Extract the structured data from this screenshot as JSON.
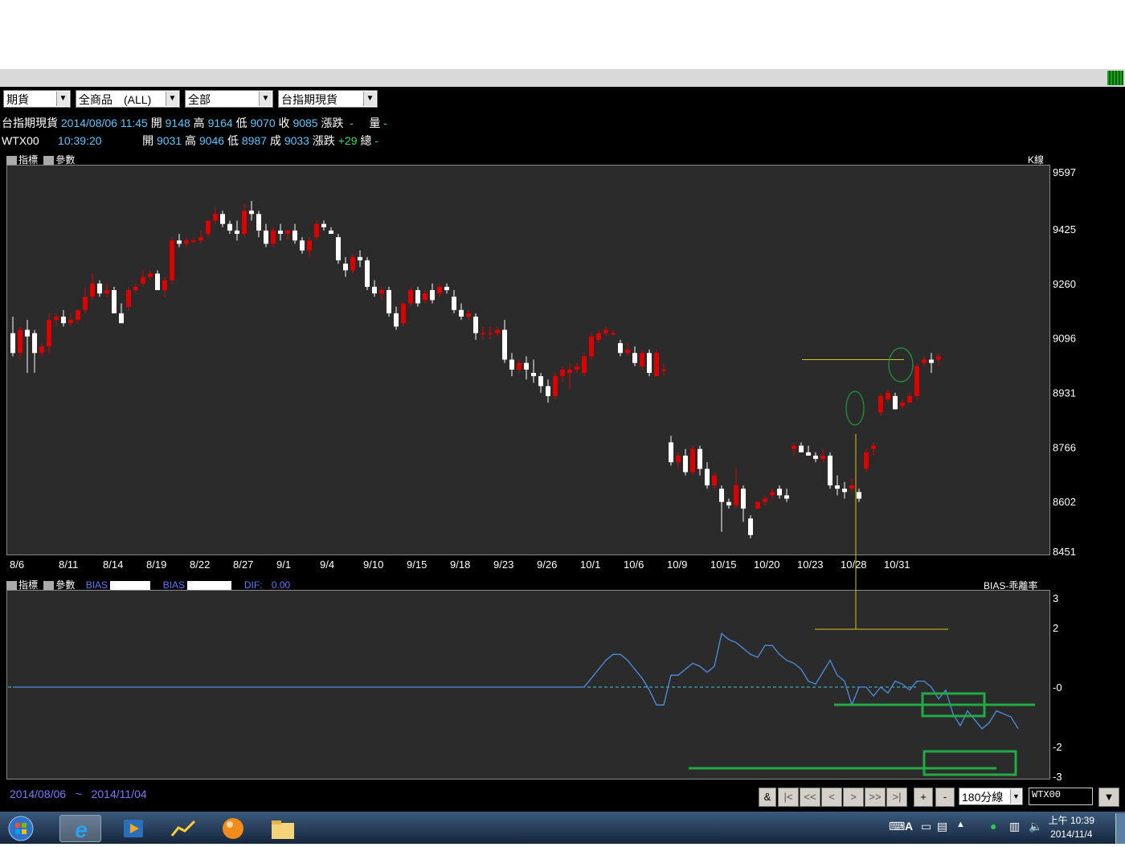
{
  "filters": {
    "market": "期貨",
    "product": "全商品　(ALL)",
    "scope": "全部",
    "symbol": "台指期現貨"
  },
  "quote_row1": {
    "name": "台指期現貨",
    "datetime": "2014/08/06 11:45",
    "open_label": "開",
    "open": "9148",
    "high_label": "高",
    "high": "9164",
    "low_label": "低",
    "low": "9070",
    "close_label": "收",
    "close": "9085",
    "change_label": "漲跌",
    "change": "-",
    "volume_label": "量",
    "volume": "-"
  },
  "quote_row2": {
    "name": "WTX00",
    "time": "10:39:20",
    "open_label": "開",
    "open": "9031",
    "high_label": "高",
    "high": "9046",
    "low_label": "低",
    "low": "8987",
    "close_label": "成",
    "close": "9033",
    "change_label": "漲跌",
    "change": "+29",
    "volume_label": "總",
    "volume": "-"
  },
  "price_panel": {
    "indicator_btn": "指標",
    "param_btn": "參數",
    "chart_type": "K線"
  },
  "bias_panel": {
    "indicator_btn": "指標",
    "param_btn": "參數",
    "bias1_label": "BIAS",
    "bias2_label": "BIAS",
    "dif_label": "DIF:",
    "dif_value": "0.00",
    "title": "BIAS-乖離率"
  },
  "chart_data": [
    {
      "type": "candlestick",
      "title": "K線",
      "ylim": [
        8451,
        9597
      ],
      "y_ticks": [
        9597,
        9425,
        9260,
        9096,
        8931,
        8766,
        8602,
        8451
      ],
      "x_ticks": [
        "8/6",
        "8/11",
        "8/14",
        "8/19",
        "8/22",
        "8/27",
        "9/1",
        "9/4",
        "9/10",
        "9/15",
        "9/18",
        "9/23",
        "9/26",
        "10/1",
        "10/6",
        "10/9",
        "10/15",
        "10/20",
        "10/23",
        "10/28",
        "10/31"
      ],
      "colors": {
        "up": "#dd0000",
        "down": "#ffffff",
        "background": "#2b2b2b"
      },
      "candles": [
        [
          9110,
          9160,
          9040,
          9050
        ],
        [
          9050,
          9130,
          9030,
          9120
        ],
        [
          9120,
          9150,
          8990,
          9100
        ],
        [
          9110,
          9120,
          8990,
          9050
        ],
        [
          9050,
          9080,
          9040,
          9070
        ],
        [
          9070,
          9170,
          9050,
          9150
        ],
        [
          9150,
          9170,
          9130,
          9160
        ],
        [
          9160,
          9180,
          9130,
          9140
        ],
        [
          9140,
          9170,
          9130,
          9150
        ],
        [
          9150,
          9180,
          9140,
          9180
        ],
        [
          9180,
          9250,
          9170,
          9220
        ],
        [
          9220,
          9290,
          9210,
          9260
        ],
        [
          9260,
          9270,
          9220,
          9230
        ],
        [
          9230,
          9260,
          9220,
          9240
        ],
        [
          9240,
          9250,
          9170,
          9170
        ],
        [
          9170,
          9200,
          9140,
          9140
        ],
        [
          9190,
          9250,
          9180,
          9240
        ],
        [
          9240,
          9260,
          9230,
          9250
        ],
        [
          9260,
          9300,
          9250,
          9280
        ],
        [
          9280,
          9300,
          9270,
          9290
        ],
        [
          9290,
          9300,
          9240,
          9240
        ],
        [
          9240,
          9280,
          9220,
          9270
        ],
        [
          9270,
          9400,
          9260,
          9390
        ],
        [
          9390,
          9410,
          9370,
          9380
        ],
        [
          9380,
          9400,
          9370,
          9390
        ],
        [
          9390,
          9400,
          9380,
          9390
        ],
        [
          9390,
          9420,
          9380,
          9400
        ],
        [
          9410,
          9450,
          9400,
          9450
        ],
        [
          9450,
          9490,
          9440,
          9470
        ],
        [
          9470,
          9480,
          9430,
          9440
        ],
        [
          9440,
          9450,
          9410,
          9420
        ],
        [
          9420,
          9450,
          9390,
          9410
        ],
        [
          9410,
          9500,
          9400,
          9480
        ],
        [
          9480,
          9510,
          9450,
          9470
        ],
        [
          9470,
          9480,
          9400,
          9420
        ],
        [
          9420,
          9440,
          9370,
          9380
        ],
        [
          9380,
          9430,
          9370,
          9420
        ],
        [
          9420,
          9440,
          9390,
          9410
        ],
        [
          9410,
          9420,
          9390,
          9420
        ],
        [
          9420,
          9440,
          9380,
          9390
        ],
        [
          9390,
          9400,
          9350,
          9360
        ],
        [
          9360,
          9400,
          9340,
          9390
        ],
        [
          9400,
          9450,
          9390,
          9440
        ],
        [
          9440,
          9450,
          9420,
          9430
        ],
        [
          9420,
          9430,
          9410,
          9410
        ],
        [
          9400,
          9410,
          9320,
          9330
        ],
        [
          9320,
          9340,
          9280,
          9300
        ],
        [
          9300,
          9350,
          9290,
          9340
        ],
        [
          9340,
          9360,
          9310,
          9330
        ],
        [
          9330,
          9340,
          9240,
          9250
        ],
        [
          9250,
          9270,
          9220,
          9230
        ],
        [
          9230,
          9250,
          9210,
          9240
        ],
        [
          9240,
          9250,
          9160,
          9170
        ],
        [
          9170,
          9190,
          9120,
          9130
        ],
        [
          9140,
          9200,
          9130,
          9200
        ],
        [
          9200,
          9250,
          9190,
          9240
        ],
        [
          9240,
          9250,
          9190,
          9200
        ],
        [
          9210,
          9240,
          9200,
          9230
        ],
        [
          9240,
          9260,
          9200,
          9210
        ],
        [
          9230,
          9260,
          9220,
          9250
        ],
        [
          9250,
          9260,
          9230,
          9240
        ],
        [
          9220,
          9240,
          9170,
          9180
        ],
        [
          9180,
          9200,
          9150,
          9160
        ],
        [
          9160,
          9180,
          9150,
          9170
        ],
        [
          9160,
          9170,
          9090,
          9110
        ],
        [
          9110,
          9130,
          9090,
          9110
        ],
        [
          9110,
          9130,
          9090,
          9110
        ],
        [
          9110,
          9130,
          9100,
          9120
        ],
        [
          9120,
          9150,
          9020,
          9030
        ],
        [
          9030,
          9050,
          8980,
          9000
        ],
        [
          9000,
          9030,
          8990,
          9020
        ],
        [
          9020,
          9040,
          8970,
          9000
        ],
        [
          8990,
          9030,
          8960,
          8980
        ],
        [
          8980,
          8990,
          8930,
          8950
        ],
        [
          8950,
          8970,
          8900,
          8920
        ],
        [
          8920,
          8990,
          8910,
          8980
        ],
        [
          8980,
          9010,
          8960,
          9000
        ],
        [
          8990,
          9020,
          8940,
          9000
        ],
        [
          9000,
          9020,
          8990,
          9010
        ],
        [
          8990,
          9050,
          8980,
          9040
        ],
        [
          9040,
          9110,
          9030,
          9100
        ],
        [
          9090,
          9120,
          9080,
          9110
        ],
        [
          9110,
          9130,
          9100,
          9120
        ],
        [
          9110,
          9120,
          9100,
          9110
        ],
        [
          9080,
          9090,
          9040,
          9050
        ],
        [
          9050,
          9080,
          9040,
          9060
        ],
        [
          9050,
          9070,
          9010,
          9020
        ],
        [
          9010,
          9060,
          9000,
          9050
        ],
        [
          9050,
          9060,
          8980,
          8990
        ],
        [
          8980,
          9060,
          8980,
          9050
        ],
        [
          9000,
          9020,
          8980,
          9000
        ],
        [
          8780,
          8800,
          8710,
          8720
        ],
        [
          8720,
          8750,
          8700,
          8740
        ],
        [
          8740,
          8760,
          8680,
          8690
        ],
        [
          8690,
          8770,
          8680,
          8760
        ],
        [
          8760,
          8770,
          8680,
          8700
        ],
        [
          8700,
          8720,
          8640,
          8650
        ],
        [
          8650,
          8690,
          8640,
          8680
        ],
        [
          8640,
          8650,
          8510,
          8600
        ],
        [
          8600,
          8610,
          8580,
          8590
        ],
        [
          8590,
          8700,
          8580,
          8650
        ],
        [
          8640,
          8650,
          8540,
          8580
        ],
        [
          8550,
          8560,
          8490,
          8500
        ],
        [
          8580,
          8600,
          8580,
          8600
        ],
        [
          8600,
          8620,
          8590,
          8610
        ],
        [
          8620,
          8640,
          8610,
          8630
        ],
        [
          8640,
          8650,
          8610,
          8620
        ],
        [
          8620,
          8640,
          8600,
          8610
        ],
        [
          8760,
          8780,
          8740,
          8770
        ],
        [
          8770,
          8780,
          8750,
          8750
        ],
        [
          8750,
          8770,
          8740,
          8740
        ],
        [
          8740,
          8750,
          8720,
          8730
        ],
        [
          8730,
          8760,
          8720,
          8740
        ],
        [
          8740,
          8750,
          8640,
          8650
        ],
        [
          8650,
          8680,
          8620,
          8640
        ],
        [
          8640,
          8660,
          8610,
          8630
        ],
        [
          8640,
          8670,
          8630,
          8650
        ],
        [
          8630,
          8640,
          8600,
          8610
        ],
        [
          8700,
          8760,
          8690,
          8750
        ],
        [
          8760,
          8780,
          8740,
          8770
        ],
        [
          8870,
          8930,
          8860,
          8920
        ],
        [
          8910,
          8940,
          8900,
          8930
        ],
        [
          8920,
          8930,
          8880,
          8880
        ],
        [
          8890,
          8910,
          8880,
          8900
        ],
        [
          8900,
          8930,
          8900,
          8920
        ],
        [
          8920,
          9020,
          8910,
          9010
        ],
        [
          9020,
          9040,
          9010,
          9030
        ],
        [
          9030,
          9050,
          8990,
          9020
        ],
        [
          9030,
          9050,
          9010,
          9040
        ]
      ]
    },
    {
      "type": "line",
      "title": "BIAS-乖離率",
      "ylim": [
        -3,
        3
      ],
      "y_ticks": [
        3,
        2,
        0,
        -2,
        -3
      ],
      "y_tick_labels": [
        "3",
        "2",
        "-0",
        "-2",
        "-3"
      ],
      "baseline": 0,
      "series": [
        {
          "color": "#4a90e2",
          "values": [
            0.0,
            0.0,
            0.0,
            0.0,
            0.0,
            0.0,
            0.0,
            0.0,
            0.0,
            0.0,
            0.0,
            0.0,
            0.0,
            0.0,
            0.0,
            0.0,
            0.0,
            0.0,
            0.0,
            0.0,
            0.0,
            0.0,
            0.0,
            0.0,
            0.0,
            0.0,
            0.0,
            0.0,
            0.0,
            0.0,
            0.0,
            0.0,
            0.0,
            0.0,
            0.0,
            0.0,
            0.0,
            0.0,
            0.0,
            0.0,
            0.0,
            0.0,
            0.0,
            0.0,
            0.0,
            0.0,
            0.0,
            0.0,
            0.0,
            0.0,
            0.0,
            0.0,
            0.0,
            0.0,
            0.0,
            0.0,
            0.0,
            0.0,
            0.0,
            0.0,
            0.0,
            0.0,
            0.0,
            0.0,
            0.0,
            0.0,
            0.0,
            0.0,
            0.0,
            0.0,
            0.0,
            0.0,
            0.0,
            0.0,
            0.0,
            0.0,
            0.0,
            0.0,
            0.0,
            0.0,
            0.3,
            0.6,
            0.9,
            1.1,
            1.1,
            0.9,
            0.6,
            0.3,
            -0.1,
            -0.6,
            -0.6,
            0.4,
            0.4,
            0.6,
            0.8,
            0.7,
            0.5,
            0.7,
            1.8,
            1.6,
            1.5,
            1.3,
            1.1,
            1.0,
            1.4,
            1.4,
            1.1,
            0.9,
            0.8,
            0.6,
            0.2,
            0.1,
            0.5,
            0.9,
            0.4,
            0.2,
            -0.6,
            0.0,
            0.0,
            -0.3,
            0.0,
            -0.2,
            0.2,
            0.1,
            -0.1,
            0.2,
            0.2,
            0.0,
            -0.4,
            -0.1,
            -0.9,
            -1.3,
            -0.8,
            -1.1,
            -1.4,
            -1.2,
            -0.8,
            -0.9,
            -1.0,
            -1.4
          ]
        }
      ]
    }
  ],
  "date_range": {
    "start": "2014/08/06",
    "sep": "~",
    "end": "2014/11/04"
  },
  "nav_buttons": [
    "&",
    "|<",
    "<<",
    "<",
    ">",
    ">>",
    ">|",
    "+",
    "-"
  ],
  "period_select": "180分線",
  "symbol_input": "WTX00",
  "taskbar": {
    "clock_time": "上午 10:39",
    "clock_date": "2014/11/4"
  }
}
